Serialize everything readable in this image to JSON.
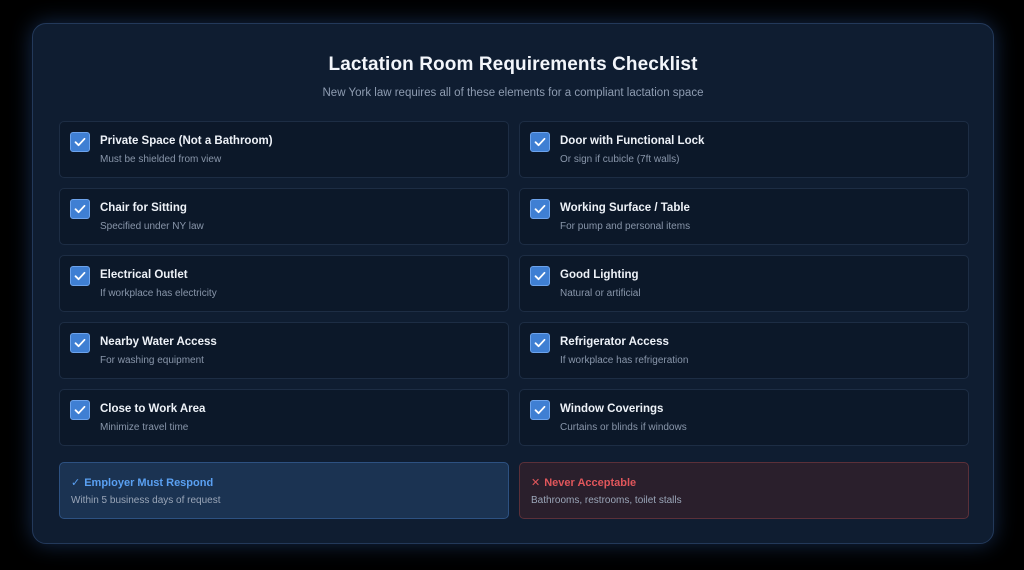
{
  "header": {
    "title": "Lactation Room Requirements Checklist",
    "subtitle": "New York law requires all of these elements for a compliant lactation space"
  },
  "checklist": [
    {
      "title": "Private Space (Not a Bathroom)",
      "desc": "Must be shielded from view",
      "checked": true
    },
    {
      "title": "Door with Functional Lock",
      "desc": "Or sign if cubicle (7ft walls)",
      "checked": true
    },
    {
      "title": "Chair for Sitting",
      "desc": "Specified under NY law",
      "checked": true
    },
    {
      "title": "Working Surface / Table",
      "desc": "For pump and personal items",
      "checked": true
    },
    {
      "title": "Electrical Outlet",
      "desc": "If workplace has electricity",
      "checked": true
    },
    {
      "title": "Good Lighting",
      "desc": "Natural or artificial",
      "checked": true
    },
    {
      "title": "Nearby Water Access",
      "desc": "For washing equipment",
      "checked": true
    },
    {
      "title": "Refrigerator Access",
      "desc": "If workplace has refrigeration",
      "checked": true
    },
    {
      "title": "Close to Work Area",
      "desc": "Minimize travel time",
      "checked": true
    },
    {
      "title": "Window Coverings",
      "desc": "Curtains or blinds if windows",
      "checked": true
    }
  ],
  "notes": {
    "positive": {
      "mark": "✓",
      "title": "Employer Must Respond",
      "desc": "Within 5 business days of request"
    },
    "negative": {
      "mark": "✕",
      "title": "Never Acceptable",
      "desc": "Bathrooms, restrooms, toilet stalls"
    }
  },
  "colors": {
    "accent": "#3f7fd3",
    "positive": "#5aa0f2",
    "negative": "#e0565b",
    "card_bg": "#0f1d31"
  }
}
